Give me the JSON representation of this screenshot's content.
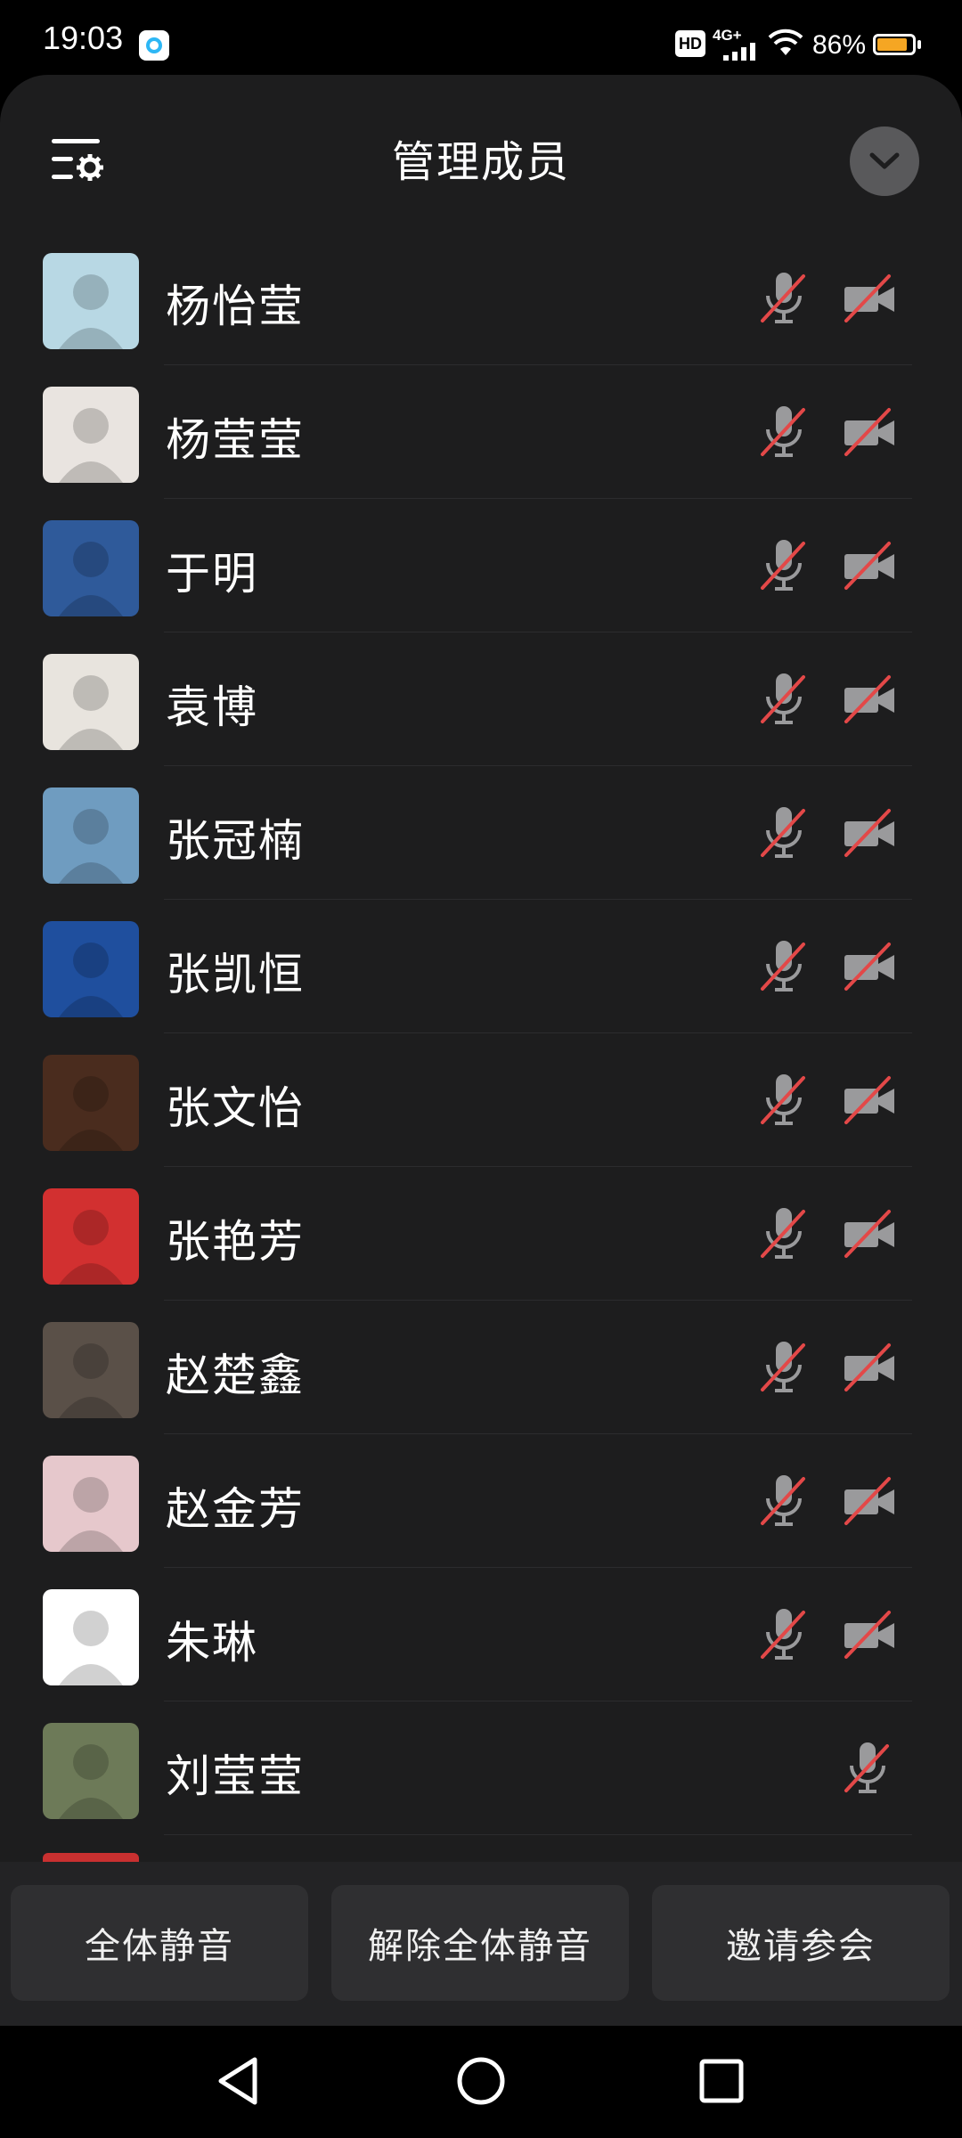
{
  "status_bar": {
    "time": "19:03",
    "hd_label": "HD",
    "network_label": "4G+",
    "battery_percent": "86%",
    "battery_level": 0.86
  },
  "header": {
    "title": "管理成员",
    "menu_icon": "menu-settings-icon",
    "collapse_icon": "chevron-down-icon"
  },
  "members": [
    {
      "name": "杨怡莹",
      "mic": "muted",
      "camera": "off",
      "avatar_color": "#b8d8e4"
    },
    {
      "name": "杨莹莹",
      "mic": "muted",
      "camera": "off",
      "avatar_color": "#e9e4e0"
    },
    {
      "name": "于明",
      "mic": "muted",
      "camera": "off",
      "avatar_color": "#2f5a9a"
    },
    {
      "name": "袁博",
      "mic": "muted",
      "camera": "off",
      "avatar_color": "#e8e4de"
    },
    {
      "name": "张冠楠",
      "mic": "muted",
      "camera": "off",
      "avatar_color": "#6f9cc0"
    },
    {
      "name": "张凯恒",
      "mic": "muted",
      "camera": "off",
      "avatar_color": "#1f4f9e"
    },
    {
      "name": "张文怡",
      "mic": "muted",
      "camera": "off",
      "avatar_color": "#4a2c1e"
    },
    {
      "name": "张艳芳",
      "mic": "muted",
      "camera": "off",
      "avatar_color": "#d23030"
    },
    {
      "name": "赵楚鑫",
      "mic": "muted",
      "camera": "off",
      "avatar_color": "#5a5048"
    },
    {
      "name": "赵金芳",
      "mic": "muted",
      "camera": "off",
      "avatar_color": "#e6c8cc"
    },
    {
      "name": "朱琳",
      "mic": "muted",
      "camera": "off",
      "avatar_color": "#ffffff"
    },
    {
      "name": "刘莹莹",
      "mic": "muted",
      "camera": "none",
      "avatar_color": "#6d7a58"
    }
  ],
  "actions": {
    "mute_all": "全体静音",
    "unmute_all": "解除全体静音",
    "invite": "邀请参会"
  },
  "colors": {
    "sheet_bg": "#1d1d1e",
    "muted_red": "#e34848",
    "icon_gray": "#9a9a9c"
  }
}
